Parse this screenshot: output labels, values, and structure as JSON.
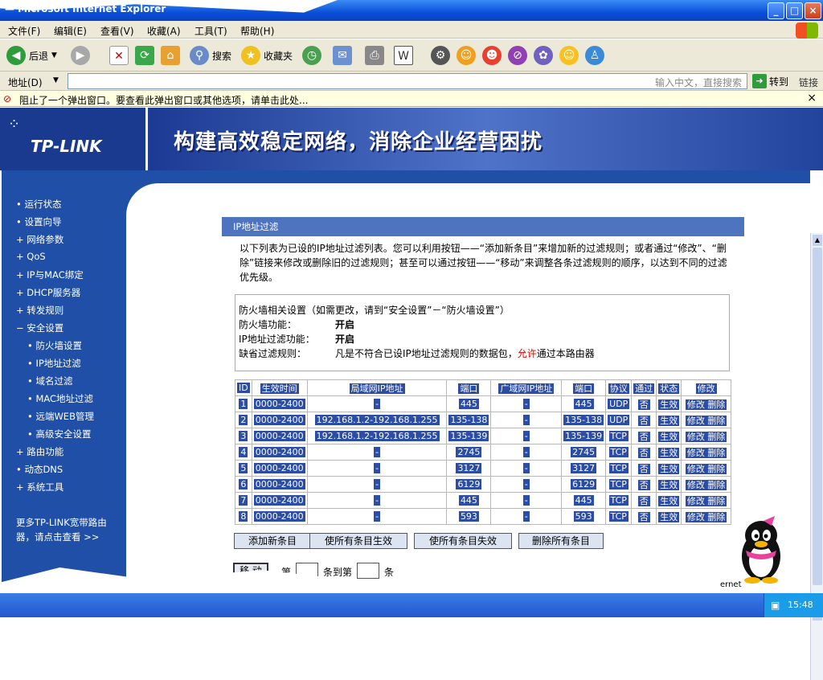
{
  "window": {
    "title": "— Microsoft Internet Explorer",
    "buttons": [
      "_",
      "□",
      "×"
    ]
  },
  "menu": [
    "文件(F)",
    "编辑(E)",
    "查看(V)",
    "收藏(A)",
    "工具(T)",
    "帮助(H)"
  ],
  "toolbar": {
    "back": "后退",
    "search": "搜索",
    "favorites": "收藏夹"
  },
  "address": {
    "label": "地址(D)",
    "placeholder": "输入中文，直接搜索",
    "go": "转到",
    "links": "链接"
  },
  "infobar": {
    "text": "阻止了一个弹出窗口。要查看此弹出窗口或其他选项，请单击此处..."
  },
  "banner": {
    "logo": "TP-LINK",
    "slogan": "构建高效稳定网络，消除企业经营困扰"
  },
  "sidebar": {
    "items": [
      {
        "label": "• 运行状态"
      },
      {
        "label": "• 设置向导"
      },
      {
        "label": "+ 网络参数"
      },
      {
        "label": "+ QoS"
      },
      {
        "label": "+ IP与MAC绑定"
      },
      {
        "label": "+ DHCP服务器"
      },
      {
        "label": "+ 转发规则"
      },
      {
        "label": "− 安全设置"
      },
      {
        "label": "• 防火墙设置"
      },
      {
        "label": "• IP地址过滤"
      },
      {
        "label": "• 域名过滤"
      },
      {
        "label": "• MAC地址过滤"
      },
      {
        "label": "• 远端WEB管理"
      },
      {
        "label": "• 高级安全设置"
      },
      {
        "label": "+ 路由功能"
      },
      {
        "label": "• 动态DNS"
      },
      {
        "label": "+ 系统工具"
      }
    ],
    "more_line1": "更多TP-LINK宽带路由",
    "more_line2": "器，请点击查看 >>"
  },
  "section": {
    "title": "IP地址过滤",
    "intro": "以下列表为已设的IP地址过滤列表。您可以利用按钮——“添加新条目”来增加新的过滤规则；或者通过“修改”、“删除”链接来修改或删除旧的过滤规则；甚至可以通过按钮——“移动”来调整各条过滤规则的顺序，以达到不同的过滤优先级。",
    "fw_header": "防火墙相关设置（如需更改，请到“安全设置”－“防火墙设置”）",
    "fw_label": "防火墙功能：",
    "fw_value": "开启",
    "ipf_label": "IP地址过滤功能：",
    "ipf_value": "开启",
    "default_label": "缺省过滤规则：",
    "default_pre": "凡是不符合已设IP地址过滤规则的数据包，",
    "default_red": "允许",
    "default_post": "通过本路由器"
  },
  "table": {
    "headers": [
      "ID",
      "生效时间",
      "局域网IP地址",
      "端口",
      "广域网IP地址",
      "端口",
      "协议",
      "通过",
      "状态",
      "修改"
    ],
    "rows": [
      [
        "1",
        "0000-2400",
        "-",
        "445",
        "-",
        "445",
        "UDP",
        "否",
        "生效",
        "修改 删除"
      ],
      [
        "2",
        "0000-2400",
        "192.168.1.2-192.168.1.255",
        "135-138",
        "-",
        "135-138",
        "UDP",
        "否",
        "生效",
        "修改 删除"
      ],
      [
        "3",
        "0000-2400",
        "192.168.1.2-192.168.1.255",
        "135-139",
        "-",
        "135-139",
        "TCP",
        "否",
        "生效",
        "修改 删除"
      ],
      [
        "4",
        "0000-2400",
        "-",
        "2745",
        "-",
        "2745",
        "TCP",
        "否",
        "生效",
        "修改 删除"
      ],
      [
        "5",
        "0000-2400",
        "-",
        "3127",
        "-",
        "3127",
        "TCP",
        "否",
        "生效",
        "修改 删除"
      ],
      [
        "6",
        "0000-2400",
        "-",
        "6129",
        "-",
        "6129",
        "TCP",
        "否",
        "生效",
        "修改 删除"
      ],
      [
        "7",
        "0000-2400",
        "-",
        "445",
        "-",
        "445",
        "TCP",
        "否",
        "生效",
        "修改 删除"
      ],
      [
        "8",
        "0000-2400",
        "-",
        "593",
        "-",
        "593",
        "TCP",
        "否",
        "生效",
        "修改 删除"
      ]
    ]
  },
  "buttons": {
    "add": "添加新条目",
    "enable_all": "使所有条目生效",
    "disable_all": "使所有条目失效",
    "delete_all": "删除所有条目"
  },
  "move": {
    "button": "移 动",
    "label_from": "第",
    "label_to": "条到第",
    "label_end": "条"
  },
  "status": {
    "zone_text": "ernet"
  },
  "taskbar": {
    "clock": "15:48"
  }
}
